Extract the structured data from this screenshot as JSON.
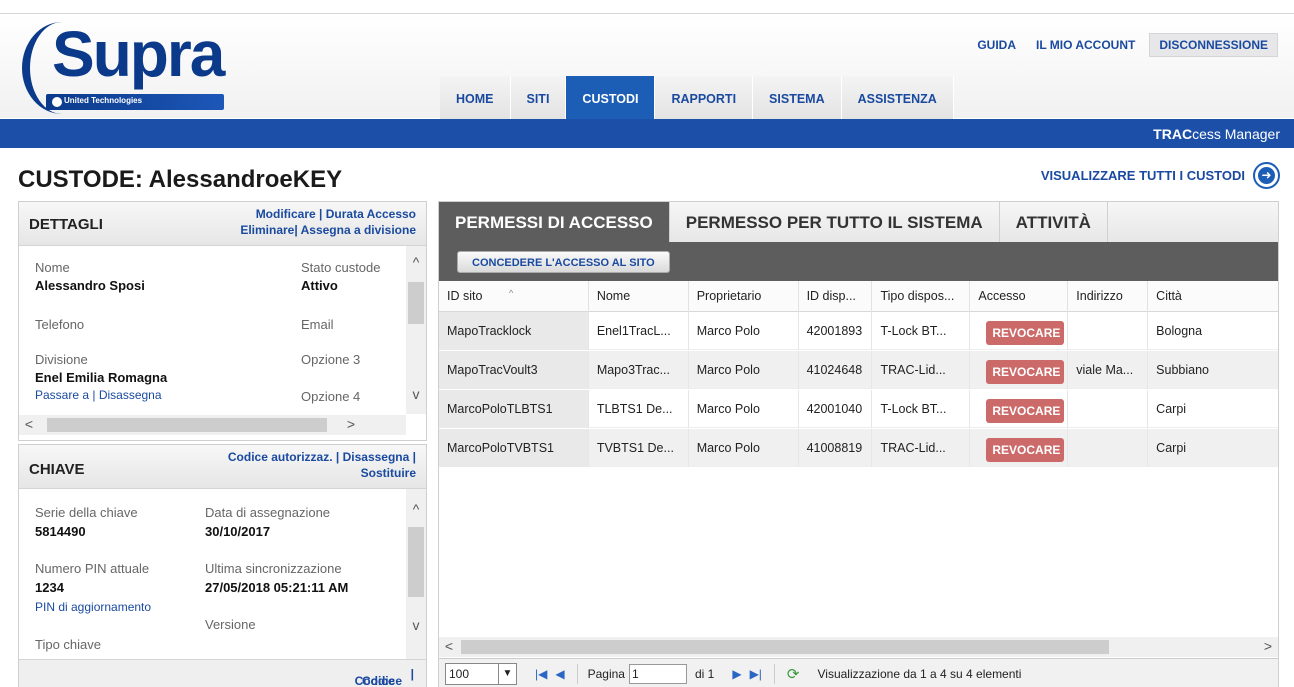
{
  "header": {
    "logo_text": "Supra",
    "logo_subtitle": "United Technologies",
    "links": [
      "GUIDA",
      "IL MIO ACCOUNT",
      "DISCONNESSIONE"
    ],
    "nav": [
      "HOME",
      "SITI",
      "CUSTODI",
      "RAPPORTI",
      "SISTEMA",
      "ASSISTENZA"
    ],
    "active_nav": "CUSTODI",
    "brand_bold": "TRAC",
    "brand_rest": "cess Manager"
  },
  "page": {
    "title": "CUSTODE: AlessandroeKEY",
    "view_all": "VISUALIZZARE TUTTI I CUSTODI"
  },
  "details": {
    "title": "DETTAGLI",
    "link_modify": "Modificare",
    "link_duration": "Durata Accesso",
    "link_delete": "Eliminare",
    "link_assign": "Assegna a divisione",
    "name_label": "Nome",
    "name_value": "Alessandro Sposi",
    "status_label": "Stato custode",
    "status_value": "Attivo",
    "phone_label": "Telefono",
    "email_label": "Email",
    "division_label": "Divisione",
    "division_value": "Enel Emilia Romagna",
    "goto_link": "Passare a",
    "unassign_link": "Disassegna",
    "option3_label": "Opzione 3",
    "option4_label": "Opzione 4"
  },
  "key": {
    "title": "CHIAVE",
    "link_auth": "Codice autorizzaz.",
    "link_unassign": "Disassegna",
    "link_replace": "Sostituire",
    "serial_label": "Serie della chiave",
    "serial_value": "5814490",
    "assign_date_label": "Data di assegnazione",
    "assign_date_value": "30/10/2017",
    "pin_label": "Numero PIN attuale",
    "pin_value": "1234",
    "pin_update_link": "PIN di aggiornamento",
    "last_sync_label": "Ultima sincronizzazione",
    "last_sync_value": "27/05/2018 05:21:11 AM",
    "version_label": "Versione",
    "key_type_label": "Tipo chiave",
    "footer_access": "Codice accesso",
    "footer_other": "Codice di ..."
  },
  "permissions": {
    "tabs": [
      "PERMESSI DI ACCESSO",
      "PERMESSO PER TUTTO IL SISTEMA",
      "ATTIVITÀ"
    ],
    "grant_button": "CONCEDERE L'ACCESSO AL SITO",
    "columns": [
      "ID sito",
      "Nome",
      "Proprietario",
      "ID disp...",
      "Tipo dispos...",
      "Accesso",
      "Indirizzo",
      "Città"
    ],
    "revoke_label": "REVOCARE",
    "rows": [
      {
        "site": "MapoTracklock",
        "name": "Enel1TracL...",
        "owner": "Marco Polo",
        "device": "42001893",
        "type": "T-Lock BT...",
        "address": "",
        "city": "Bologna"
      },
      {
        "site": "MapoTracVoult3",
        "name": "Mapo3Trac...",
        "owner": "Marco Polo",
        "device": "41024648",
        "type": "TRAC-Lid...",
        "address": "viale Ma...",
        "city": "Subbiano"
      },
      {
        "site": "MarcoPoloTLBTS1",
        "name": "TLBTS1 De...",
        "owner": "Marco Polo",
        "device": "42001040",
        "type": "T-Lock BT...",
        "address": "",
        "city": "Carpi"
      },
      {
        "site": "MarcoPoloTVBTS1",
        "name": "TVBTS1 De...",
        "owner": "Marco Polo",
        "device": "41008819",
        "type": "TRAC-Lid...",
        "address": "",
        "city": "Carpi"
      }
    ],
    "pager": {
      "page_size": "100",
      "page_label": "Pagina",
      "page_value": "1",
      "of_label": "di 1",
      "summary": "Visualizzazione da 1 a 4 su 4 elementi"
    }
  },
  "colors": {
    "brand_blue": "#1c50a8",
    "link_blue": "#1a4aa0",
    "revoke_red": "#cc6a6a",
    "toolbar_gray": "#5d5d5d"
  }
}
